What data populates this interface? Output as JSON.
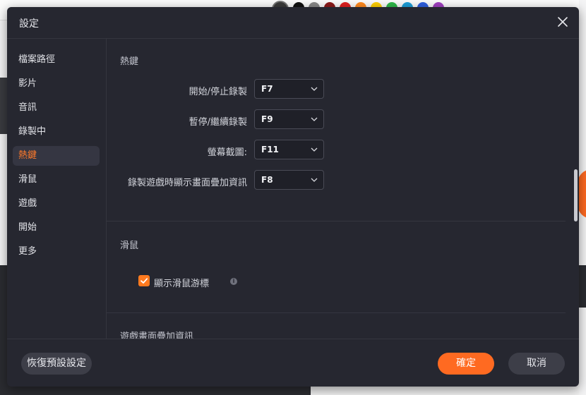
{
  "dialog": {
    "title": "設定",
    "sidebar": {
      "items": [
        {
          "label": "檔案路徑"
        },
        {
          "label": "影片"
        },
        {
          "label": "音訊"
        },
        {
          "label": "錄製中"
        },
        {
          "label": "熱鍵",
          "active": true
        },
        {
          "label": "滑鼠"
        },
        {
          "label": "遊戲"
        },
        {
          "label": "開始"
        },
        {
          "label": "更多"
        }
      ]
    },
    "hotkeys": {
      "section_title": "熱鍵",
      "rows": [
        {
          "label": "開始/停止錄製",
          "value": "F7"
        },
        {
          "label": "暫停/繼續錄製",
          "value": "F9"
        },
        {
          "label": "螢幕截圖:",
          "value": "F11"
        },
        {
          "label": "錄製遊戲時顯示畫面疊加資訊",
          "value": "F8"
        }
      ]
    },
    "mouse": {
      "section_title": "滑鼠",
      "show_cursor_label": "顯示滑鼠游標",
      "show_cursor_checked": true,
      "info_glyph": "i"
    },
    "overlay": {
      "section_title": "遊戲畫面疊加資訊"
    },
    "footer": {
      "reset_label": "恢復預設設定",
      "ok_label": "確定",
      "cancel_label": "取消"
    }
  },
  "colors": {
    "accent": "#ff6a21",
    "dialog_bg": "#262730",
    "active_nav_bg": "#353642"
  },
  "background": {
    "palette": [
      "#3b3b3b",
      "#111111",
      "#888888",
      "#8b1a1a",
      "#e02020",
      "#ff8a1f",
      "#ffd000",
      "#2fb84a",
      "#1e9fd8",
      "#3060e0",
      "#a040c0"
    ]
  }
}
